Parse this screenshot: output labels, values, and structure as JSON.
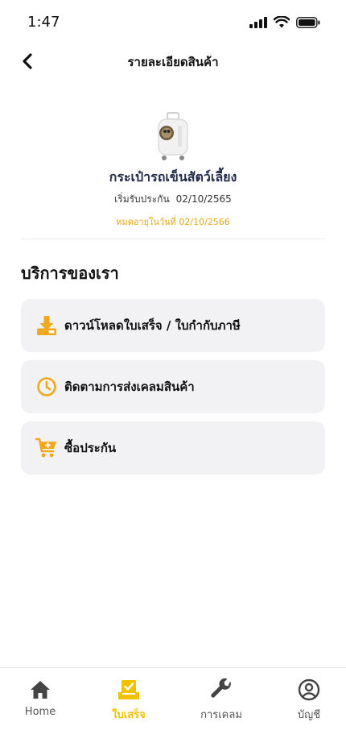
{
  "status_bar": {
    "time": "1:47"
  },
  "header": {
    "title": "รายละเอียดสินค้า"
  },
  "product": {
    "name": "กระเป๋ารถเข็นสัตว์เลี้ยง",
    "start_label": "เริ่มรับประกัน",
    "start_date": "02/10/2565",
    "expiry": "หมดอายุในวันที่ 02/10/2566"
  },
  "services": {
    "title": "บริการของเรา",
    "items": [
      {
        "label": "ดาวน์โหลดใบเสร็จ / ใบกำกับภาษี",
        "icon": "download-receipt-icon"
      },
      {
        "label": "ติดตามการส่งเคลมสินค้า",
        "icon": "clock-icon"
      },
      {
        "label": "ซื้อประกัน",
        "icon": "cart-plus-icon"
      }
    ]
  },
  "bottom_nav": {
    "items": [
      {
        "label": "Home",
        "icon": "home-icon"
      },
      {
        "label": "ใบเสร็จ",
        "icon": "receipt-check-icon",
        "active": true
      },
      {
        "label": "การเคลม",
        "icon": "wrench-icon"
      },
      {
        "label": "บัญชี",
        "icon": "user-circle-icon"
      }
    ]
  },
  "colors": {
    "accent": "#f2c200",
    "icon_orange": "#f0a81e",
    "expiry_text": "#e3a81a",
    "card_bg": "#f2f2f4"
  }
}
